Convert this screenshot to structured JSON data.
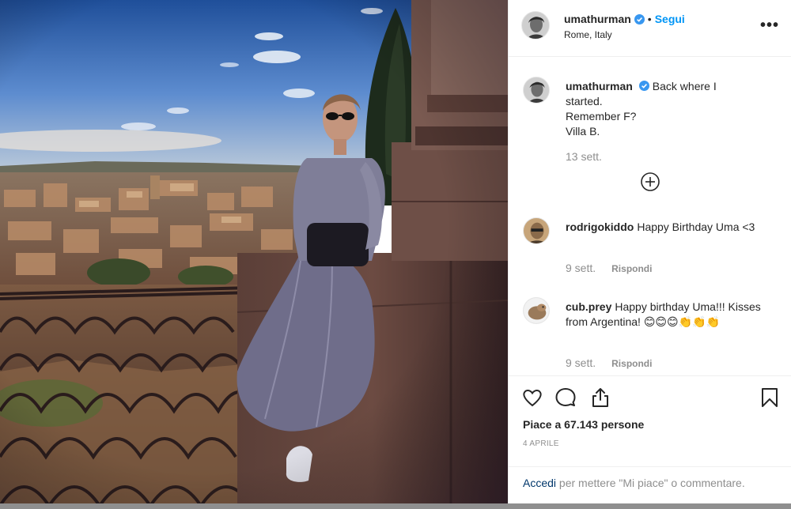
{
  "post": {
    "author": "umathurman",
    "follow_label": "Segui",
    "separator": "•",
    "location": "Rome, Italy",
    "more_label": "•••"
  },
  "caption": {
    "username": "umathurman",
    "lines": [
      "Back where I",
      "started.",
      "Remember F?",
      "Villa B."
    ],
    "time": "13 sett."
  },
  "comments": [
    {
      "username": "rodrigokiddo",
      "text": "Happy Birthday Uma <3",
      "time": "9 sett.",
      "reply_label": "Rispondi"
    },
    {
      "username": "cub.prey",
      "text": "Happy birthday Uma!!! Kisses from Argentina! 😊😊😊👏👏👏",
      "time": "9 sett.",
      "reply_label": "Rispondi"
    }
  ],
  "actions": {
    "likes_text": "Piace a 67.143 persone",
    "date": "4 APRILE"
  },
  "login": {
    "link": "Accedi",
    "rest": " per mettere \"Mi piace\" o commentare."
  },
  "colors": {
    "link_blue": "#0095f6",
    "text": "#262626",
    "muted": "#8e8e8e",
    "verified": "#3897f0"
  },
  "icons": {
    "heart": "heart-icon",
    "comment": "comment-icon",
    "share": "share-icon",
    "bookmark": "bookmark-icon",
    "verified": "verified-badge-icon",
    "load_more": "plus-circle-icon"
  }
}
